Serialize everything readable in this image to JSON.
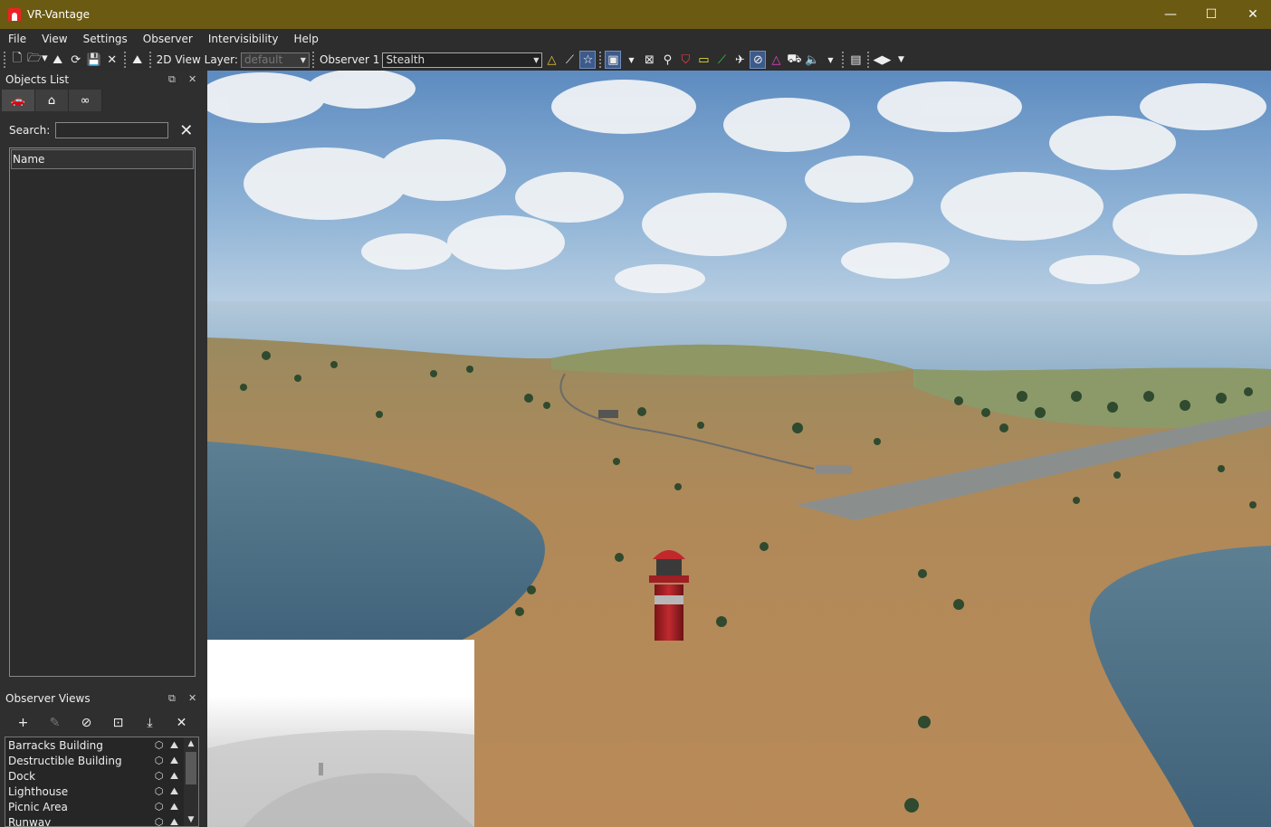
{
  "window": {
    "title": "VR-Vantage",
    "controls": {
      "minimize": "—",
      "maximize": "☐",
      "close": "✕"
    }
  },
  "menu": [
    "File",
    "View",
    "Settings",
    "Observer",
    "Intervisibility",
    "Help"
  ],
  "toolbar": {
    "view_layer_label": "2D View Layer:",
    "view_layer_value": "default",
    "observer_label": "Observer 1",
    "observer_mode": "Stealth"
  },
  "objects_panel": {
    "title": "Objects List",
    "search_label": "Search:",
    "search_value": "",
    "column_name": "Name"
  },
  "observer_panel": {
    "title": "Observer Views",
    "items": [
      {
        "name": "Barracks Building"
      },
      {
        "name": "Destructible Building"
      },
      {
        "name": "Dock"
      },
      {
        "name": "Lighthouse"
      },
      {
        "name": "Picnic Area"
      },
      {
        "name": "Runway"
      }
    ]
  },
  "colors": {
    "titlebar": "#6b5a12",
    "panel_bg": "#2f2f2f",
    "sky": "#7aa3c9",
    "sand": "#b98a57",
    "water": "#4a6e86",
    "lighthouse_red": "#b1242a"
  },
  "icons": {
    "new": "new-file-icon",
    "open": "open-folder-icon",
    "terrain": "terrain-icon",
    "reload": "reload-icon",
    "save": "save-icon",
    "close": "close-icon"
  }
}
